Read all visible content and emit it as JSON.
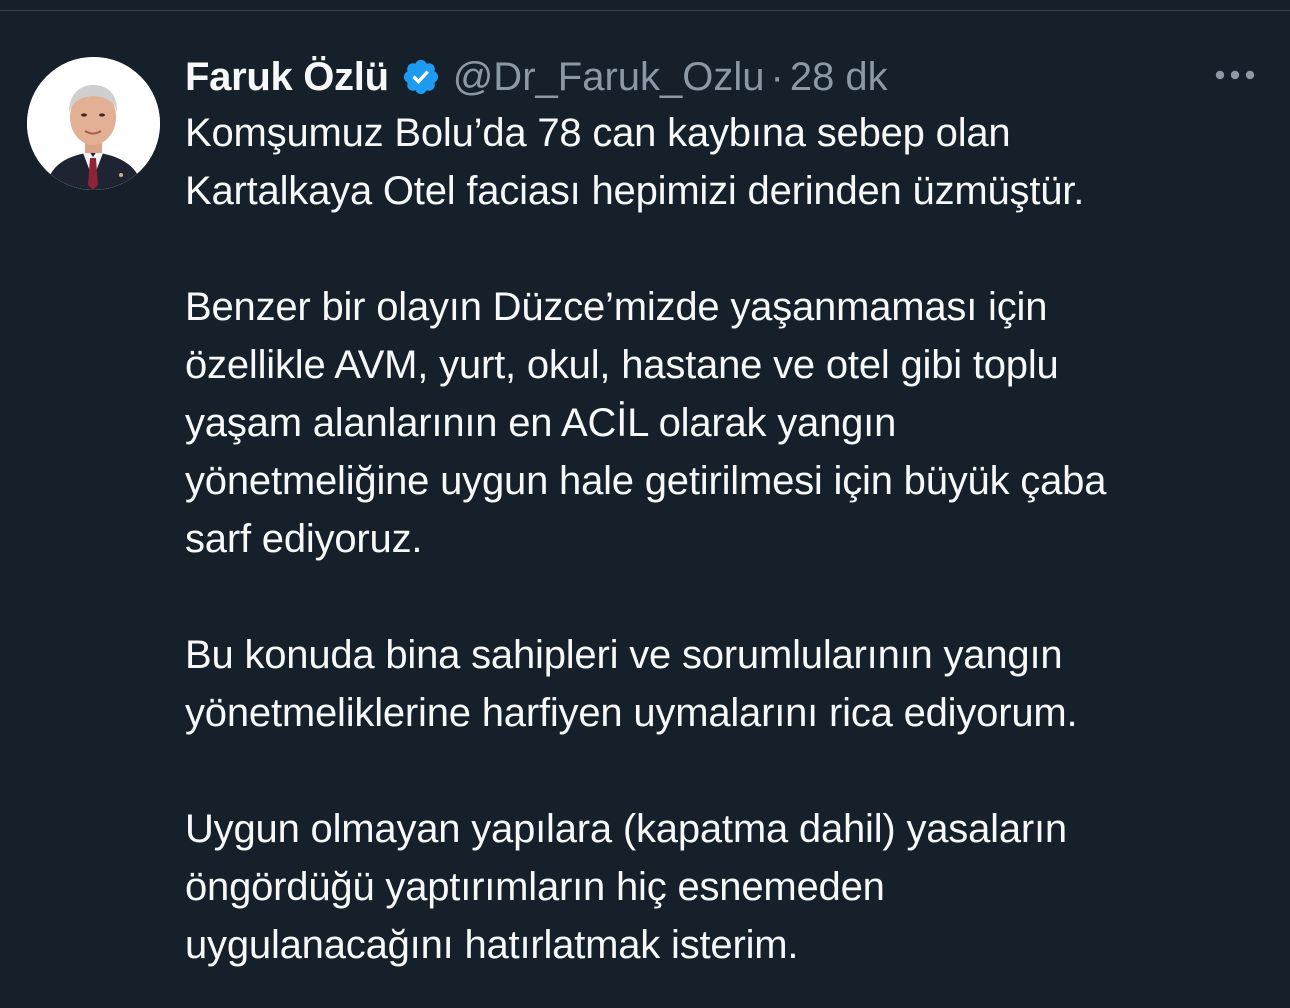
{
  "tweet": {
    "author": {
      "display_name": "Faruk Özlü",
      "handle": "@Dr_Faruk_Ozlu",
      "verified": true,
      "verified_icon": "verified-badge-icon",
      "avatar_icon": "profile-photo"
    },
    "separator": "·",
    "time": "28 dk",
    "more_icon": "more-options-icon",
    "text_lines": [
      "Komşumuz Bolu’da 78 can kaybına sebep olan",
      "Kartalkaya Otel faciası hepimizi derinden üzmüştür.",
      "",
      "Benzer bir olayın Düzce’mizde yaşanmaması için",
      "özellikle AVM, yurt, okul, hastane ve otel gibi toplu",
      "yaşam alanlarının en ACİL olarak yangın",
      "yönetmeliğine uygun hale getirilmesi için büyük çaba",
      "sarf ediyoruz.",
      "",
      "Bu konuda bina sahipleri ve sorumlularının yangın",
      "yönetmeliklerine harfiyen uymalarını rica ediyorum.",
      "",
      "Uygun olmayan yapılara (kapatma dahil) yasaların",
      "öngördüğü yaptırımların hiç esnemeden",
      "uygulanacağını hatırlatmak isterim."
    ]
  },
  "colors": {
    "background": "#15202b",
    "primary_text": "#f7f9f9",
    "secondary_text": "#8b98a5",
    "verified_blue": "#1d9bf0",
    "divider": "#38444d"
  }
}
